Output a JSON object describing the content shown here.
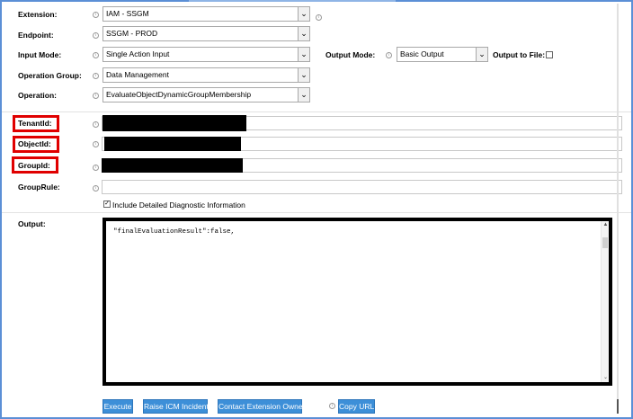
{
  "fields": {
    "extension": {
      "label": "Extension:",
      "value": "IAM - SSGM"
    },
    "endpoint": {
      "label": "Endpoint:",
      "value": "SSGM - PROD"
    },
    "input_mode": {
      "label": "Input Mode:",
      "value": "Single Action Input"
    },
    "output_mode": {
      "label": "Output Mode:",
      "value": "Basic Output"
    },
    "output_to_file": {
      "label": "Output to File:",
      "checked": false
    },
    "operation_group": {
      "label": "Operation Group:",
      "value": "Data Management"
    },
    "operation": {
      "label": "Operation:",
      "value": "EvaluateObjectDynamicGroupMembership"
    },
    "tenant_id": {
      "label": "TenantId:",
      "value": ""
    },
    "object_id": {
      "label": "ObjectId:",
      "value": ""
    },
    "group_id": {
      "label": "GroupId:",
      "value": ""
    },
    "group_rule": {
      "label": "GroupRule:",
      "value": ""
    },
    "include_diag": {
      "label": "Include Detailed Diagnostic Information",
      "checked": true
    }
  },
  "output": {
    "label": "Output:",
    "text": "\"finalEvaluationResult\":false,"
  },
  "buttons": {
    "execute": "Execute",
    "raise_icm": "Raise ICM Incident",
    "contact_owner": "Contact Extension Owner",
    "copy_url": "Copy URL"
  },
  "icons": {
    "info": "info-icon",
    "dropdown": "chevron-down-icon",
    "check": "checkmark-icon"
  },
  "colors": {
    "button_bg": "#3d8fd8",
    "highlight": "#e00000",
    "frame": "#5b8fd6"
  }
}
